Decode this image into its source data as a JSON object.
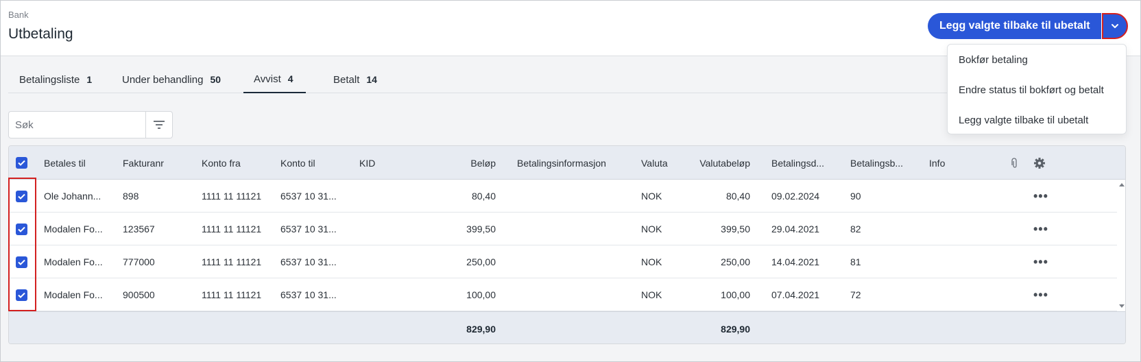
{
  "header": {
    "breadcrumb": "Bank",
    "title": "Utbetaling",
    "primary_action": "Legg valgte tilbake til ubetalt",
    "toggle_icon": "chevron-down-icon"
  },
  "dropdown": {
    "items": [
      "Bokfør betaling",
      "Endre status til bokført og betalt",
      "Legg valgte tilbake til ubetalt"
    ]
  },
  "tabs": [
    {
      "label": "Betalingsliste",
      "count": "1"
    },
    {
      "label": "Under behandling",
      "count": "50"
    },
    {
      "label": "Avvist",
      "count": "4"
    },
    {
      "label": "Betalt",
      "count": "14"
    }
  ],
  "active_tab": "Avvist",
  "search": {
    "placeholder": "Søk",
    "value": ""
  },
  "table": {
    "columns": [
      "Betales til",
      "Fakturanr",
      "Konto fra",
      "Konto til",
      "KID",
      "Beløp",
      "Betalingsinformasjon",
      "Valuta",
      "Valutabeløp",
      "Betalingsd...",
      "Betalingsb...",
      "Info"
    ],
    "rows": [
      {
        "betales_til": "Ole Johann...",
        "fakturanr": "898",
        "konto_fra": "1111 11 11121",
        "konto_til": "6537 10 31...",
        "kid": "",
        "belop": "80,40",
        "betalingsinfo": "",
        "valuta": "NOK",
        "valutabelop": "80,40",
        "betalingsdato": "09.02.2024",
        "betalingsb": "90",
        "info": "",
        "checked": true
      },
      {
        "betales_til": "Modalen Fo...",
        "fakturanr": "123567",
        "konto_fra": "1111 11 11121",
        "konto_til": "6537 10 31...",
        "kid": "",
        "belop": "399,50",
        "betalingsinfo": "",
        "valuta": "NOK",
        "valutabelop": "399,50",
        "betalingsdato": "29.04.2021",
        "betalingsb": "82",
        "info": "",
        "checked": true
      },
      {
        "betales_til": "Modalen Fo...",
        "fakturanr": "777000",
        "konto_fra": "1111 11 11121",
        "konto_til": "6537 10 31...",
        "kid": "",
        "belop": "250,00",
        "betalingsinfo": "",
        "valuta": "NOK",
        "valutabelop": "250,00",
        "betalingsdato": "14.04.2021",
        "betalingsb": "81",
        "info": "",
        "checked": true
      },
      {
        "betales_til": "Modalen Fo...",
        "fakturanr": "900500",
        "konto_fra": "1111 11 11121",
        "konto_til": "6537 10 31...",
        "kid": "",
        "belop": "100,00",
        "betalingsinfo": "",
        "valuta": "NOK",
        "valutabelop": "100,00",
        "betalingsdato": "07.04.2021",
        "betalingsb": "72",
        "info": "",
        "checked": true
      }
    ],
    "totals": {
      "belop": "829,90",
      "valutabelop": "829,90"
    }
  },
  "colors": {
    "primary": "#2a57d8",
    "highlight": "#d32020",
    "header_bg": "#e7ebf2"
  }
}
